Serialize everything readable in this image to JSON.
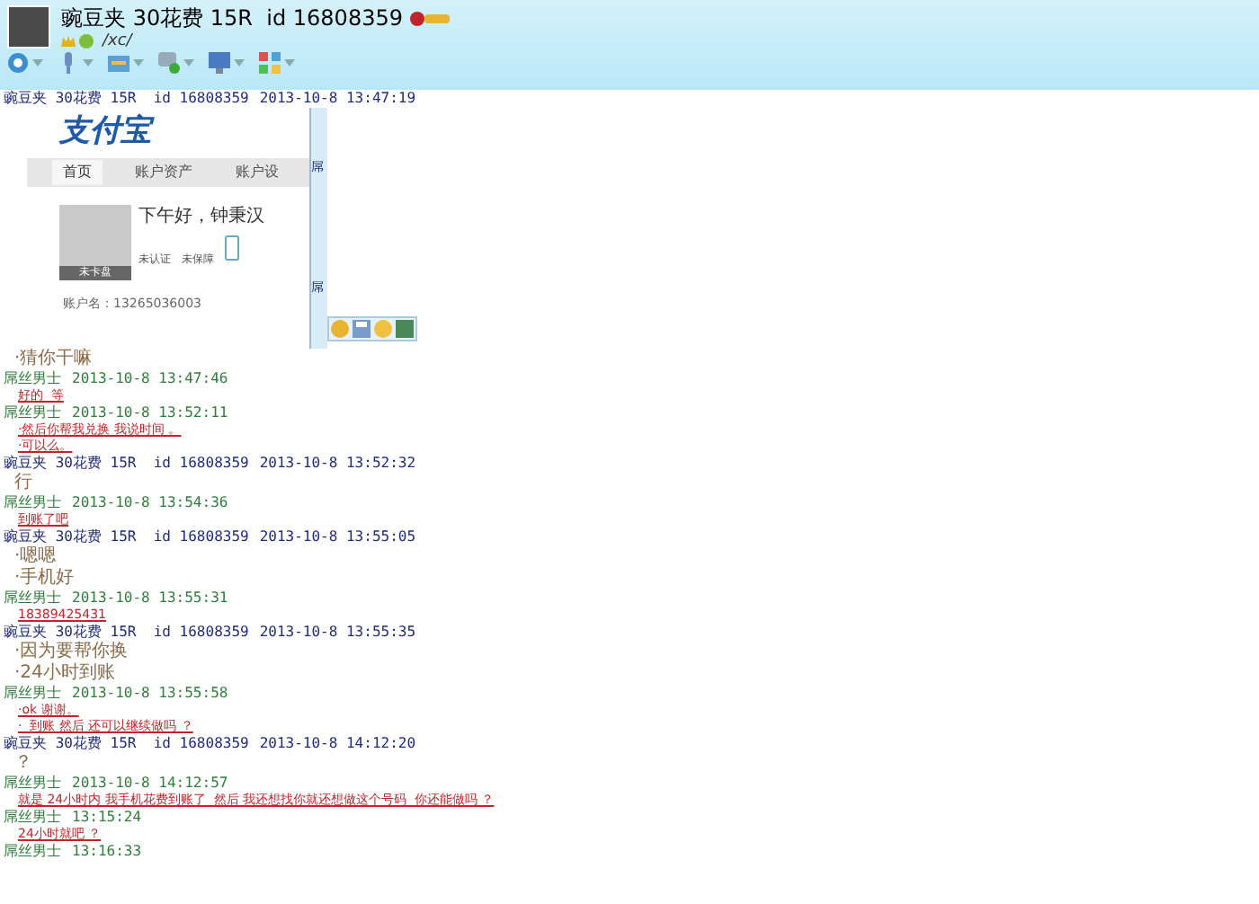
{
  "contact": {
    "name": "豌豆夹 30花费 15R  id 16808359",
    "signature": "/xc/"
  },
  "first_header": {
    "sender": "豌豆夹 30花费 15R  id 16808359",
    "time": "2013-10-8 13:47:19",
    "kind": "contact"
  },
  "shared_image": {
    "logo": "支付宝",
    "tabs": [
      {
        "label": "首页",
        "selected": true
      },
      {
        "label": "账户资产",
        "selected": false
      },
      {
        "label": "账户设",
        "selected": false
      }
    ],
    "greeting": "下午好，钟秉汉",
    "avatar_label": "未卡盘",
    "badges": [
      "未认证",
      "未保障"
    ],
    "account": "账户名：13265036003",
    "side_chars": [
      "屌",
      "屌"
    ]
  },
  "messages": [
    {
      "lines": [
        {
          "kind": "large",
          "text": "·猜你干嘛"
        }
      ]
    },
    {
      "header": {
        "sender": "屌丝男士",
        "time": "2013-10-8 13:47:46",
        "kind": "user"
      },
      "lines": [
        {
          "kind": "link",
          "text": "好的  等"
        }
      ]
    },
    {
      "header": {
        "sender": "屌丝男士",
        "time": "2013-10-8 13:52:11",
        "kind": "user"
      },
      "lines": [
        {
          "kind": "link",
          "text": "·然后你帮我兑换 我说时间 。"
        },
        {
          "kind": "link",
          "text": "·可以么。"
        }
      ]
    },
    {
      "header": {
        "sender": "豌豆夹 30花费 15R  id 16808359",
        "time": "2013-10-8 13:52:32",
        "kind": "contact"
      },
      "lines": [
        {
          "kind": "large",
          "text": "行"
        }
      ]
    },
    {
      "header": {
        "sender": "屌丝男士",
        "time": "2013-10-8 13:54:36",
        "kind": "user"
      },
      "lines": [
        {
          "kind": "link",
          "text": "到账了吧"
        }
      ]
    },
    {
      "header": {
        "sender": "豌豆夹 30花费 15R  id 16808359",
        "time": "2013-10-8 13:55:05",
        "kind": "contact"
      },
      "lines": [
        {
          "kind": "large",
          "text": "·嗯嗯"
        },
        {
          "kind": "large",
          "text": "·手机好"
        }
      ]
    },
    {
      "header": {
        "sender": "屌丝男士",
        "time": "2013-10-8 13:55:31",
        "kind": "user"
      },
      "lines": [
        {
          "kind": "link",
          "text": "18389425431"
        }
      ]
    },
    {
      "header": {
        "sender": "豌豆夹 30花费 15R  id 16808359",
        "time": "2013-10-8 13:55:35",
        "kind": "contact"
      },
      "lines": [
        {
          "kind": "large",
          "text": "·因为要帮你换"
        },
        {
          "kind": "large",
          "text": "·24小时到账"
        }
      ]
    },
    {
      "header": {
        "sender": "屌丝男士",
        "time": "2013-10-8 13:55:58",
        "kind": "user"
      },
      "lines": [
        {
          "kind": "link",
          "text": "·ok 谢谢。"
        },
        {
          "kind": "link",
          "text": "·  到账 然后 还可以继续做吗 ？"
        }
      ]
    },
    {
      "header": {
        "sender": "豌豆夹 30花费 15R  id 16808359",
        "time": "2013-10-8 14:12:20",
        "kind": "contact"
      },
      "lines": [
        {
          "kind": "large",
          "text": "？"
        }
      ]
    },
    {
      "header": {
        "sender": "屌丝男士",
        "time": "2013-10-8 14:12:57",
        "kind": "user"
      },
      "lines": [
        {
          "kind": "link",
          "text": "就是 24小时内 我手机花费到账了  然后 我还想找你就还想做这个号码  你还能做吗 ？"
        }
      ]
    },
    {
      "header": {
        "sender": "屌丝男士",
        "time": "13:15:24",
        "kind": "user"
      },
      "lines": [
        {
          "kind": "link",
          "text": "24小时就吧 ？"
        }
      ]
    },
    {
      "header": {
        "sender": "屌丝男士",
        "time": "13:16:33",
        "kind": "user"
      }
    }
  ]
}
